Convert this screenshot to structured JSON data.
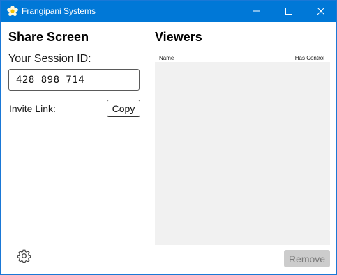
{
  "window": {
    "title": "Frangipani Systems",
    "title_bar_color": "#0078d7",
    "app_icon": "frangipani-flower-icon"
  },
  "titlebar_buttons": {
    "minimize_icon": "minimize-icon",
    "maximize_icon": "maximize-icon",
    "close_icon": "close-icon"
  },
  "left_panel": {
    "heading": "Share Screen",
    "session_label": "Your Session ID:",
    "session_id": "428 898 714",
    "invite_label": "Invite Link:",
    "copy_label": "Copy"
  },
  "right_panel": {
    "heading": "Viewers",
    "columns": [
      "Name",
      "Has Control"
    ],
    "rows": [],
    "remove_label": "Remove",
    "remove_enabled": false
  },
  "footer": {
    "settings_icon": "gear-icon"
  }
}
